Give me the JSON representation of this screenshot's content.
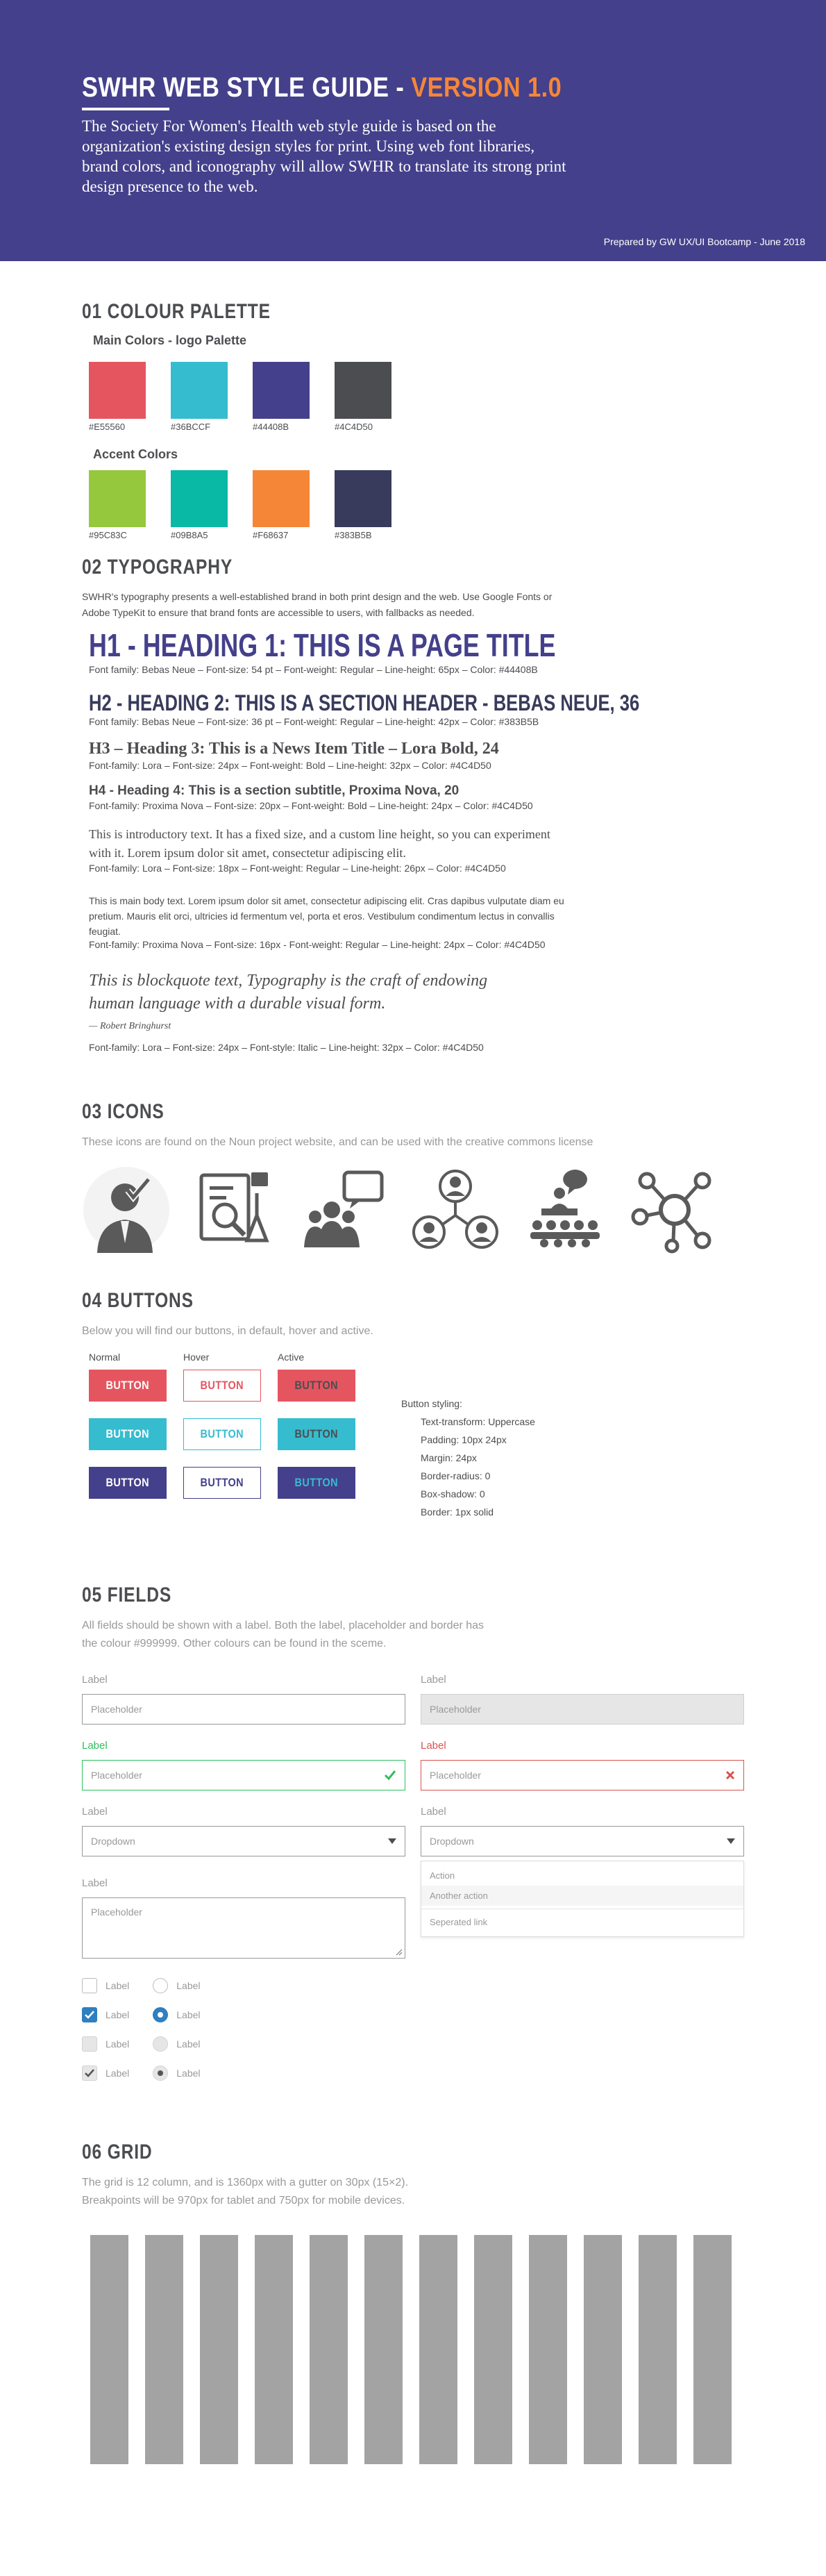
{
  "header": {
    "title_main": "SWHR WEB STYLE GUIDE - ",
    "title_version": "VERSION 1.0",
    "intro": "The Society For Women's Health web style guide is based on the organization's existing design styles for print. Using web font libraries, brand colors, and iconography will allow SWHR to translate its strong print design presence to the web.",
    "credit": "Prepared by GW UX/UI Bootcamp - June 2018"
  },
  "colours": {
    "title": "01 COLOUR PALETTE",
    "main_title": "Main Colors - logo Palette",
    "main": [
      {
        "code": "#E55560",
        "hex": "#E55560"
      },
      {
        "code": "#36BCCF",
        "hex": "#36BCCF"
      },
      {
        "code": "#44408B",
        "hex": "#44408B"
      },
      {
        "code": "#4C4D50",
        "hex": "#4C4D50"
      }
    ],
    "accent_title": "Accent Colors",
    "accent": [
      {
        "code": "#95C83C",
        "hex": "#95C83C"
      },
      {
        "code": "#09B8A5",
        "hex": "#09B8A5"
      },
      {
        "code": "#F68637",
        "hex": "#F68637"
      },
      {
        "code": "#383B5B",
        "hex": "#383B5B"
      }
    ]
  },
  "typography": {
    "title": "02 TYPOGRAPHY",
    "intro": "SWHR's typography presents a well-established brand in both print design and the web. Use Google Fonts or Adobe TypeKit to ensure that brand fonts are accessible to users, with fallbacks as needed.",
    "h1": "H1 - HEADING 1: THIS IS A PAGE TITLE",
    "h1_spec": "Font family: Bebas Neue – Font-size: 54 pt – Font-weight: Regular – Line-height: 65px – Color: #44408B",
    "h2": "H2 - HEADING 2: THIS IS A SECTION HEADER - BEBAS NEUE, 36",
    "h2_spec": "Font family: Bebas Neue – Font-size: 36 pt – Font-weight: Regular – Line-height: 42px – Color: #383B5B",
    "h3": "H3 – Heading 3: This is a News Item Title – Lora Bold, 24",
    "h3_spec": "Font-family: Lora – Font-size: 24px – Font-weight: Bold – Line-height: 32px – Color: #4C4D50",
    "h4": "H4 - Heading 4: This is a section subtitle, Proxima Nova, 20",
    "h4_spec": "Font-family: Proxima Nova – Font-size: 20px – Font-weight: Bold – Line-height: 24px – Color: #4C4D50",
    "intro_text": "This is introductory text. It has a fixed size, and a custom line height, so you can experiment with it. Lorem ipsum dolor sit amet, consectetur adipiscing elit.",
    "intro_spec": "Font-family: Lora – Font-size: 18px – Font-weight: Regular – Line-height: 26px – Color: #4C4D50",
    "main_text": "This is main body text. Lorem ipsum dolor sit amet, consectetur adipiscing elit. Cras dapibus vulputate diam eu pretium. Mauris elit orci, ultricies id fermentum vel, porta et eros. Vestibulum condimentum lectus in convallis feugiat.",
    "main_spec": "Font-family: Proxima Nova – Font-size: 16px - Font-weight: Regular – Line-height: 24px – Color: #4C4D50",
    "quote": "This is blockquote text, Typography is the craft of endowing human language with a durable visual form.",
    "quote_cite": "— Robert Bringhurst",
    "quote_spec": "Font-family: Lora – Font-size: 24px – Font-style: Italic – Line-height: 32px – Color: #4C4D50"
  },
  "icons": {
    "title": "03 ICONS",
    "description": "These icons are found on the Noun project website, and can be used with the creative commons license",
    "items": [
      "approved-businessman-icon",
      "research-document-icon",
      "group-discussion-icon",
      "people-network-icon",
      "conference-speaker-icon",
      "network-hub-icon"
    ]
  },
  "buttons": {
    "title": "04 BUTTONS",
    "description": "Below you will find our buttons, in default, hover and active.",
    "col_normal": "Normal",
    "col_hover": "Hover",
    "col_active": "Active",
    "label": "BUTTON",
    "styling_title": "Button styling:",
    "styling": [
      "Text-transform: Uppercase",
      "Padding: 10px 24px",
      "Margin: 24px",
      "Border-radius: 0",
      "Box-shadow: 0",
      "Border: 1px solid"
    ]
  },
  "fields": {
    "title": "05 FIELDS",
    "description": "All fields should be shown with a label. Both the label, placeholder and border has the colour #999999. Other colours can be found in the sceme.",
    "label": "Label",
    "placeholder": "Placeholder",
    "dropdown": "Dropdown",
    "menu": [
      "Action",
      "Another action",
      "Seperated link"
    ]
  },
  "grid": {
    "title": "06 GRID",
    "description_1": "The grid is 12 column, and is 1360px with a gutter on 30px (15×2).",
    "description_2": "Breakpoints will be 970px for tablet and 750px for mobile devices."
  }
}
